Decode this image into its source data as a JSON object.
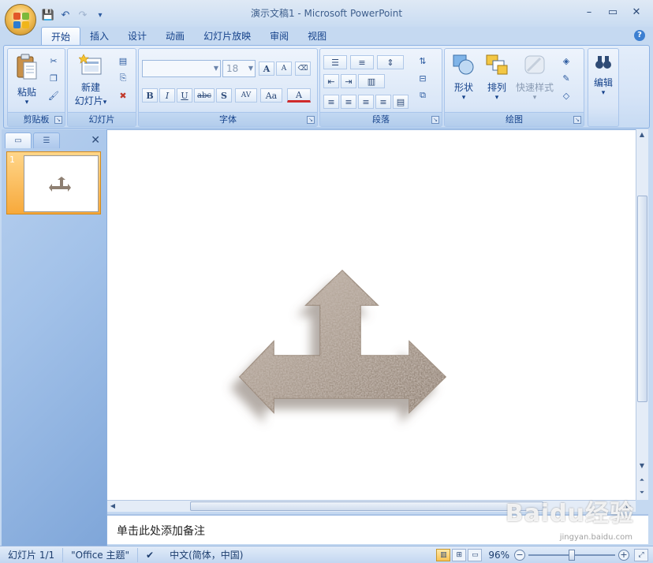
{
  "window": {
    "title": "演示文稿1 - Microsoft PowerPoint",
    "minimize": "–",
    "maximize": "▭",
    "close": "✕"
  },
  "qat": {
    "save": "💾",
    "undo": "↶",
    "redo": "↷",
    "customize": "▾"
  },
  "tabs": [
    {
      "label": "开始",
      "active": true
    },
    {
      "label": "插入"
    },
    {
      "label": "设计"
    },
    {
      "label": "动画"
    },
    {
      "label": "幻灯片放映"
    },
    {
      "label": "审阅"
    },
    {
      "label": "视图"
    }
  ],
  "ribbon": {
    "clipboard": {
      "group": "剪贴板",
      "paste": "粘贴",
      "dropdown": "▾"
    },
    "slides": {
      "group": "幻灯片",
      "new_slide_line1": "新建",
      "new_slide_line2": "幻灯片",
      "dropdown": "▾"
    },
    "font": {
      "group": "字体",
      "font_name": "",
      "font_size": "18",
      "bold": "B",
      "italic": "I",
      "underline": "U",
      "strike": "abc",
      "shadow": "S",
      "spacing": "AV",
      "case": "Aa",
      "color": "A",
      "grow": "A",
      "shrink": "A"
    },
    "paragraph": {
      "group": "段落"
    },
    "drawing": {
      "group": "绘图",
      "shapes": "形状",
      "arrange": "排列",
      "quick_styles": "快速样式"
    },
    "editing": {
      "group": "编辑"
    }
  },
  "slides_pane": {
    "slide_number": "1",
    "close": "✕"
  },
  "notes": {
    "placeholder": "单击此处添加备注"
  },
  "watermark": {
    "brand": "Baidu经验",
    "url": "jingyan.baidu.com"
  },
  "statusbar": {
    "slide": "幻灯片 1/1",
    "theme": "\"Office 主题\"",
    "language": "中文(简体，中国)",
    "zoom": "96%",
    "zoom_fraction": 0.5
  },
  "colors": {
    "ribbon_bg": "#d6e4f7",
    "accent": "#15428b",
    "thumb_selected": "#f7a93b"
  }
}
